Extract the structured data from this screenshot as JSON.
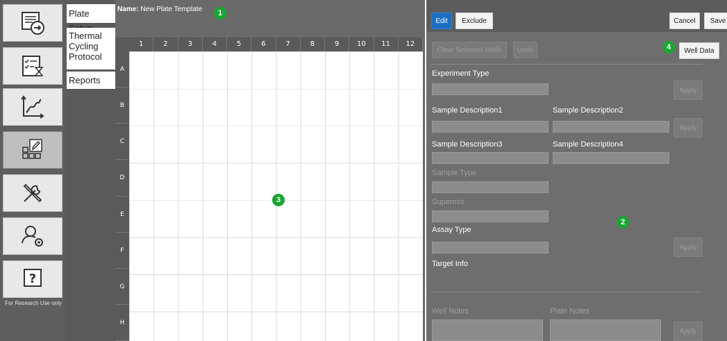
{
  "rail": {
    "items": [
      {
        "icon": "export-icon"
      },
      {
        "icon": "checklist-timer-icon"
      },
      {
        "icon": "chart-icon"
      },
      {
        "icon": "plate-edit-icon"
      },
      {
        "icon": "tools-icon"
      },
      {
        "icon": "user-settings-icon"
      },
      {
        "icon": "help-icon"
      }
    ],
    "footer": "For Research Use only"
  },
  "subnav": {
    "items": [
      {
        "label": "Plate Setup"
      },
      {
        "label": "Thermal Cycling Protocol"
      },
      {
        "label": "Reports"
      }
    ]
  },
  "plate": {
    "name_label": "Name:",
    "name_value": "New Plate Template",
    "columns": [
      "1",
      "2",
      "3",
      "4",
      "5",
      "6",
      "7",
      "8",
      "9",
      "10",
      "11",
      "12"
    ],
    "rows": [
      "A",
      "B",
      "C",
      "D",
      "E",
      "F",
      "G",
      "H"
    ]
  },
  "toolbar": {
    "edit_label": "Edit",
    "exclude_label": "Exclude",
    "cancel_label": "Cancel",
    "save_label": "Save"
  },
  "panel": {
    "clear_label": "Clear Selected Wells",
    "undo_label": "Undo",
    "well_data_label": "Well Data",
    "experiment_type_label": "Experiment Type",
    "apply_label": "Apply",
    "sample_desc1_label": "Sample Description1",
    "sample_desc2_label": "Sample Description2",
    "sample_desc3_label": "Sample Description3",
    "sample_desc4_label": "Sample Description4",
    "sample_type_label": "Sample Type",
    "supermix_label": "Supermix",
    "assay_type_label": "Assay Type",
    "target_info_label": "Target Info",
    "well_notes_label": "Well Notes",
    "plate_notes_label": "Plate Notes"
  },
  "callouts": {
    "one": "1",
    "two": "2",
    "three": "3",
    "four": "4"
  },
  "colors": {
    "accent_blue": "#1c6fc0",
    "callout_green": "#1aa632",
    "panel_gray": "#6e6e6e"
  }
}
